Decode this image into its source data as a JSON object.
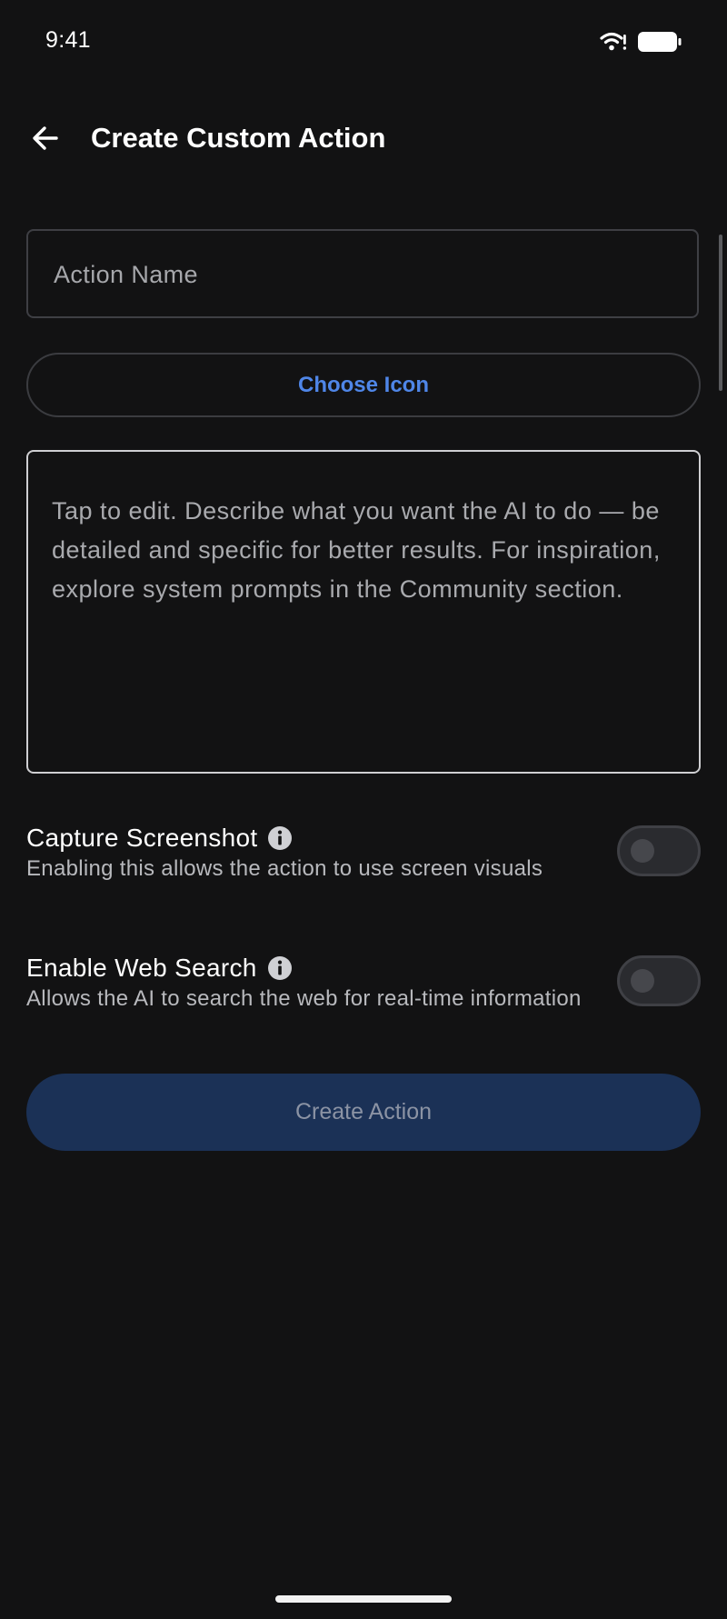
{
  "status_bar": {
    "time": "9:41",
    "icons": [
      "wifi-icon",
      "battery-icon"
    ]
  },
  "app_bar": {
    "back_icon": "arrow-left-icon",
    "title": "Create Custom Action"
  },
  "form": {
    "action_name": {
      "value": "",
      "placeholder": "Action Name"
    },
    "choose_icon_label": "Choose Icon",
    "prompt": {
      "value": "",
      "placeholder": "Tap to edit. Describe what you want the AI to do — be detailed and specific for better results. For inspiration, explore system prompts in the Community section."
    },
    "capture_screenshot": {
      "title": "Capture Screenshot",
      "description": "Enabling this allows the action to use screen visuals",
      "enabled": false,
      "info_icon": "info-icon"
    },
    "web_search": {
      "title": "Enable Web Search",
      "description": "Allows the AI to search the web for real-time information",
      "enabled": false,
      "info_icon": "info-icon"
    },
    "create_label": "Create Action"
  },
  "colors": {
    "background": "#121213",
    "accent": "#4f86e8",
    "create_button_bg": "#1b3156",
    "create_button_text": "#8b93a4",
    "border": "#3e3f44"
  }
}
